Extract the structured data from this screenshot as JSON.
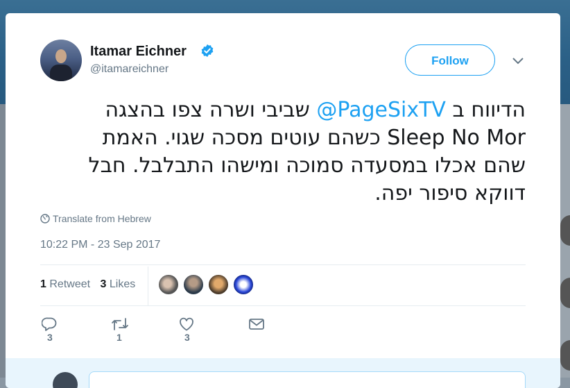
{
  "tweet": {
    "author_name": "Itamar Eichner",
    "handle": "@itamareichner",
    "follow_label": "Follow",
    "text_line1_prefix": "הדיווח ב ",
    "mention": "@PageSixTV",
    "text_line1_suffix": " שביבי ושרה צפו בהצגה",
    "text_line2": "Sleep No Mor כשהם עוטים מסכה שגוי.  האמת",
    "text_line3": "שהם אכלו במסעדה סמוכה ומישהו התבלבל. חבל",
    "text_line4": "דווקא סיפור יפה.",
    "translate_label": "Translate from Hebrew",
    "timestamp": "10:22 PM - 23 Sep 2017",
    "retweet_count": "1",
    "retweet_label": "Retweet",
    "like_count": "3",
    "like_label": "Likes",
    "actions": {
      "reply_count": "3",
      "retweet_count": "1",
      "like_count": "3"
    }
  },
  "colors": {
    "accent": "#1da1f2",
    "text": "#14171a",
    "muted": "#657786"
  },
  "icons": [
    "verified-badge-icon",
    "chevron-down-icon",
    "globe-icon",
    "reply-icon",
    "retweet-icon",
    "heart-icon",
    "envelope-icon"
  ]
}
